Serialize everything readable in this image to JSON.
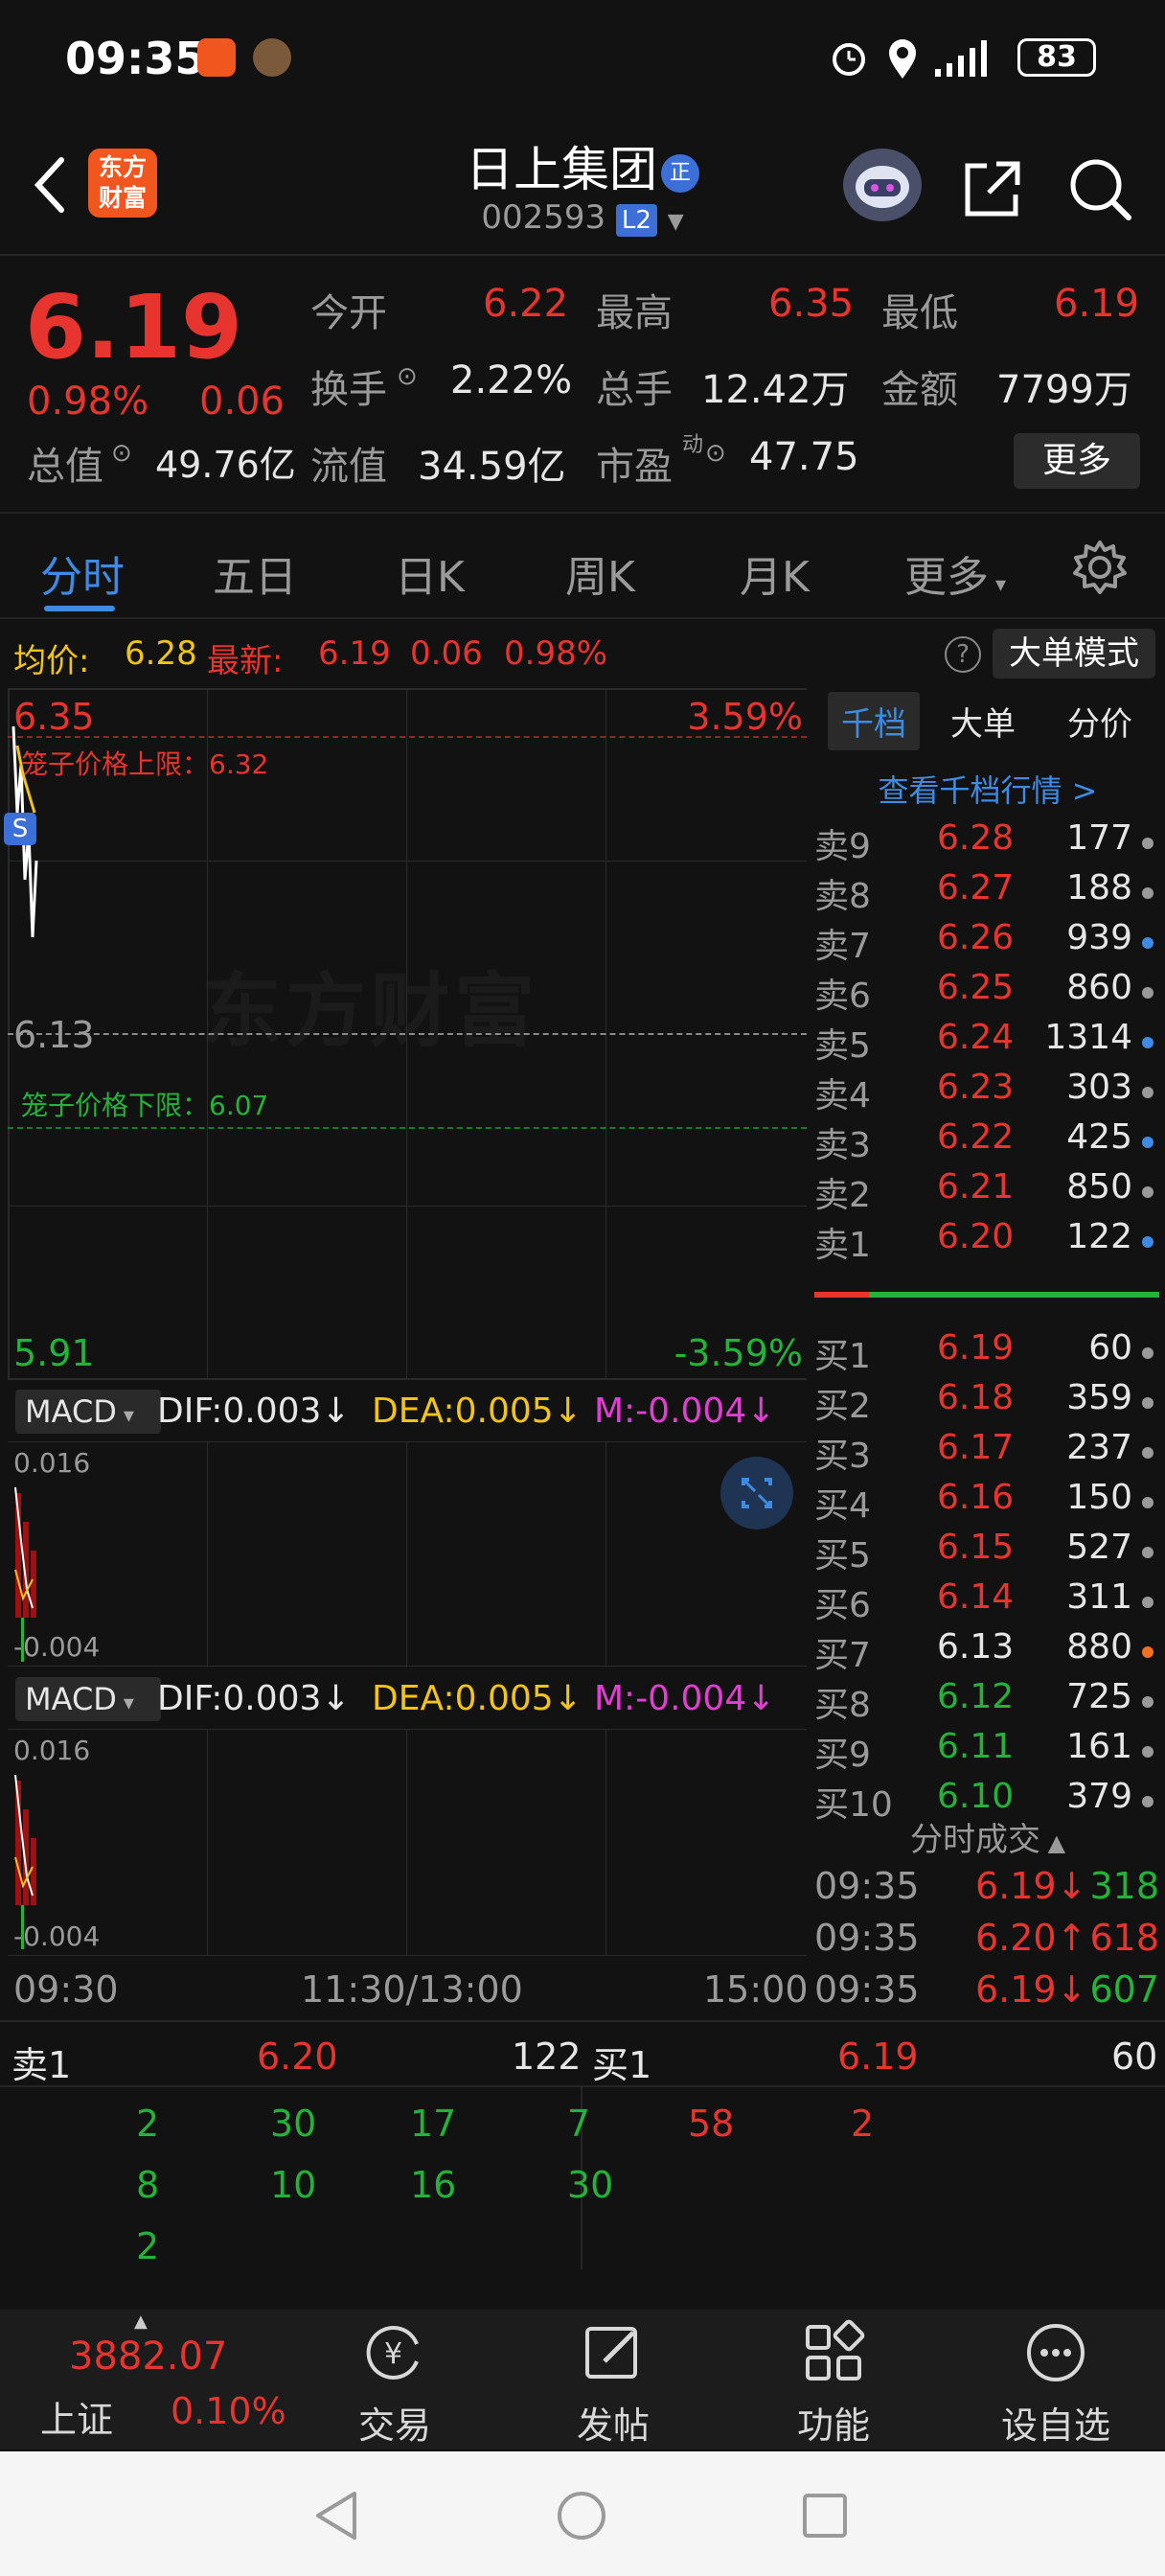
{
  "status_bar": {
    "time": "09:35",
    "battery": "83",
    "icons": [
      "alarm-icon",
      "location-icon",
      "signal-icon",
      "battery-icon"
    ]
  },
  "header": {
    "stock_name": "日上集团",
    "badge": "正",
    "stock_code": "002593",
    "level_badge": "L2",
    "logo_text_line1": "东方",
    "logo_text_line2": "财富"
  },
  "quote": {
    "price": "6.19",
    "change_pct": "0.98%",
    "change": "0.06",
    "fields": [
      {
        "label": "今开",
        "value": "6.22",
        "color": "red"
      },
      {
        "label": "最高",
        "value": "6.35",
        "color": "red"
      },
      {
        "label": "最低",
        "value": "6.19",
        "color": "red"
      },
      {
        "label": "换手",
        "value": "2.22%",
        "color": "white"
      },
      {
        "label": "总手",
        "value": "12.42万",
        "color": "white"
      },
      {
        "label": "金额",
        "value": "7799万",
        "color": "white"
      },
      {
        "label": "总值",
        "value": "49.76亿",
        "color": "white"
      },
      {
        "label": "流值",
        "value": "34.59亿",
        "color": "white"
      },
      {
        "label": "市盈",
        "value": "47.75",
        "color": "white"
      }
    ],
    "pe_sup": "动",
    "more_label": "更多"
  },
  "tabs": [
    "分时",
    "五日",
    "日K",
    "周K",
    "月K",
    "更多"
  ],
  "info_row": {
    "avg_label": "均价:",
    "avg_value": "6.28",
    "latest_label": "最新:",
    "latest_value": "6.19",
    "latest_change": "0.06",
    "latest_pct": "0.98%",
    "big_order_label": "大单模式",
    "help": "?"
  },
  "chart": {
    "top_price": "6.35",
    "top_pct": "3.59%",
    "upper_limit_label": "笼子价格上限：6.32",
    "mid_price": "6.13",
    "lower_limit_label": "笼子价格下限：6.07",
    "bottom_price": "5.91",
    "bottom_pct": "-3.59%",
    "watermark": "东方财富",
    "s_marker": "S",
    "x_start": "09:30",
    "x_mid": "11:30/13:00",
    "x_end": "15:00",
    "macd_panels": [
      {
        "label": "MACD",
        "dif": "DIF:0.003↓",
        "dea": "DEA:0.005↓",
        "m": "M:-0.004↓",
        "ymax": "0.016",
        "ymin": "-0.004"
      },
      {
        "label": "MACD",
        "dif": "DIF:0.003↓",
        "dea": "DEA:0.005↓",
        "m": "M:-0.004↓",
        "ymax": "0.016",
        "ymin": "-0.004"
      }
    ]
  },
  "order_book": {
    "tabs": [
      "千档",
      "大单",
      "分价"
    ],
    "link": "查看千档行情 >",
    "asks": [
      {
        "label": "卖9",
        "price": "6.28",
        "vol": "177",
        "dot": "#9a9a9a"
      },
      {
        "label": "卖8",
        "price": "6.27",
        "vol": "188",
        "dot": "#9a9a9a"
      },
      {
        "label": "卖7",
        "price": "6.26",
        "vol": "939",
        "dot": "#3f8be3"
      },
      {
        "label": "卖6",
        "price": "6.25",
        "vol": "860",
        "dot": "#9a9a9a"
      },
      {
        "label": "卖5",
        "price": "6.24",
        "vol": "1314",
        "dot": "#3f8be3"
      },
      {
        "label": "卖4",
        "price": "6.23",
        "vol": "303",
        "dot": "#9a9a9a"
      },
      {
        "label": "卖3",
        "price": "6.22",
        "vol": "425",
        "dot": "#3f8be3"
      },
      {
        "label": "卖2",
        "price": "6.21",
        "vol": "850",
        "dot": "#9a9a9a"
      },
      {
        "label": "卖1",
        "price": "6.20",
        "vol": "122",
        "dot": "#3f8be3"
      }
    ],
    "bids": [
      {
        "label": "买1",
        "price": "6.19",
        "vol": "60",
        "color": "red",
        "dot": "#9a9a9a"
      },
      {
        "label": "买2",
        "price": "6.18",
        "vol": "359",
        "color": "red",
        "dot": "#9a9a9a"
      },
      {
        "label": "买3",
        "price": "6.17",
        "vol": "237",
        "color": "red",
        "dot": "#9a9a9a"
      },
      {
        "label": "买4",
        "price": "6.16",
        "vol": "150",
        "color": "red",
        "dot": "#9a9a9a"
      },
      {
        "label": "买5",
        "price": "6.15",
        "vol": "527",
        "color": "red",
        "dot": "#9a9a9a"
      },
      {
        "label": "买6",
        "price": "6.14",
        "vol": "311",
        "color": "red",
        "dot": "#9a9a9a"
      },
      {
        "label": "买7",
        "price": "6.13",
        "vol": "880",
        "color": "white",
        "dot": "#f2701f"
      },
      {
        "label": "买8",
        "price": "6.12",
        "vol": "725",
        "color": "green",
        "dot": "#9a9a9a"
      },
      {
        "label": "买9",
        "price": "6.11",
        "vol": "161",
        "color": "green",
        "dot": "#9a9a9a"
      },
      {
        "label": "买10",
        "price": "6.10",
        "vol": "379",
        "color": "green",
        "dot": "#9a9a9a"
      }
    ],
    "ticks_title": "分时成交",
    "ticks": [
      {
        "time": "09:35",
        "price": "6.19↓",
        "vol": "318",
        "pcolor": "red",
        "vcolor": "green"
      },
      {
        "time": "09:35",
        "price": "6.20↑",
        "vol": "618",
        "pcolor": "red",
        "vcolor": "red"
      },
      {
        "time": "09:35",
        "price": "6.19↓",
        "vol": "607",
        "pcolor": "red",
        "vcolor": "green"
      }
    ]
  },
  "detail": {
    "sell_label": "卖1",
    "sell_price": "6.20",
    "sell_total": "122",
    "buy_label": "买1",
    "buy_price": "6.19",
    "buy_total": "60",
    "sell_queue": [
      [
        "2",
        "30",
        "17",
        "7"
      ],
      [
        "8",
        "10",
        "16",
        "30"
      ],
      [
        "2"
      ]
    ],
    "buy_queue": [
      "58",
      "2"
    ]
  },
  "bottom_nav": {
    "index_value": "3882.07",
    "index_name": "上证",
    "index_pct": "0.10%",
    "items": [
      {
        "label": "交易",
        "icon": "yen-cycle-icon"
      },
      {
        "label": "发帖",
        "icon": "edit-icon"
      },
      {
        "label": "功能",
        "icon": "grid-icon"
      },
      {
        "label": "设自选",
        "icon": "more-dots-icon"
      }
    ]
  }
}
